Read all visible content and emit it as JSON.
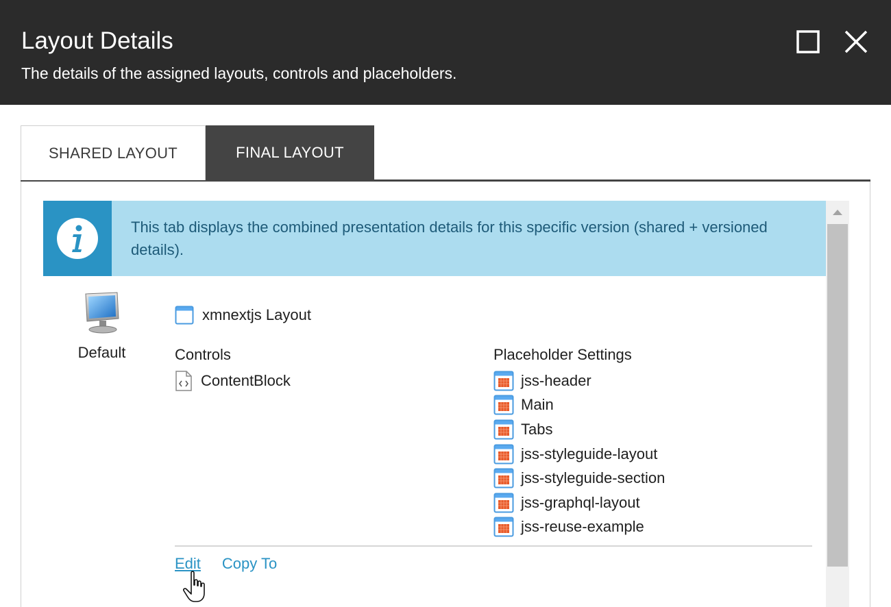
{
  "dialog": {
    "title": "Layout Details",
    "subtitle": "The details of the assigned layouts, controls and placeholders.",
    "maximize_icon": "maximize-icon",
    "close_icon": "close-icon"
  },
  "tabs": [
    {
      "label": "SHARED LAYOUT",
      "active": false
    },
    {
      "label": "FINAL LAYOUT",
      "active": true
    }
  ],
  "info": {
    "icon": "info-icon",
    "text": "This tab displays the combined presentation details for this specific version (shared + versioned details)."
  },
  "device": {
    "icon": "monitor-icon",
    "label": "Default"
  },
  "layout": {
    "icon": "layout-window-icon",
    "name": "xmnextjs Layout"
  },
  "controls": {
    "title": "Controls",
    "items": [
      {
        "name": "ContentBlock",
        "icon": "code-file-icon"
      }
    ]
  },
  "placeholders": {
    "title": "Placeholder Settings",
    "items": [
      {
        "name": "jss-header",
        "icon": "placeholder-icon"
      },
      {
        "name": "Main",
        "icon": "placeholder-icon"
      },
      {
        "name": "Tabs",
        "icon": "placeholder-icon"
      },
      {
        "name": "jss-styleguide-layout",
        "icon": "placeholder-icon"
      },
      {
        "name": "jss-styleguide-section",
        "icon": "placeholder-icon"
      },
      {
        "name": "jss-graphql-layout",
        "icon": "placeholder-icon"
      },
      {
        "name": "jss-reuse-example",
        "icon": "placeholder-icon"
      }
    ]
  },
  "actions": {
    "edit_label": "Edit",
    "copy_label": "Copy To"
  },
  "colors": {
    "header_bg": "#2b2b2b",
    "tab_active_bg": "#444444",
    "info_bg": "#acdcef",
    "info_icon_bg": "#2a93c4",
    "link": "#2a93c4"
  }
}
